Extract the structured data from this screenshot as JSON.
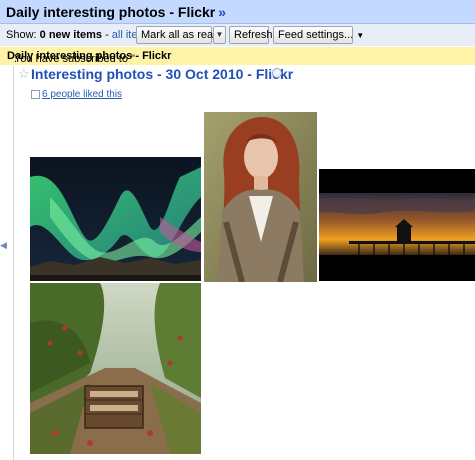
{
  "feed": {
    "title": "Daily interesting photos - Flickr",
    "title_suffix": "»"
  },
  "toolbar": {
    "show_label": "Show:",
    "new_items": "0 new items",
    "separator": "-",
    "all_items": "all items",
    "mark_all_read": "Mark all as read",
    "refresh": "Refresh",
    "feed_settings": "Feed settings..."
  },
  "banner": {
    "prefix": "You have subscribed to \"",
    "feed_name": "Daily interesting photos - Flickr",
    "suffix": ".\""
  },
  "item": {
    "title": "Interesting photos - 30 Oct 2010 - Flickr",
    "likes": "6 people liked this"
  },
  "colors": {
    "header_bg": "#c3d9ff",
    "toolbar_bg": "#e8eef7",
    "banner_bg": "#fff3a8",
    "link": "#2050b8"
  },
  "icons": [
    "raquo-icon",
    "dropdown-arrow-icon",
    "star-icon",
    "external-link-icon",
    "like-checkbox-icon",
    "collapse-arrow-icon"
  ]
}
